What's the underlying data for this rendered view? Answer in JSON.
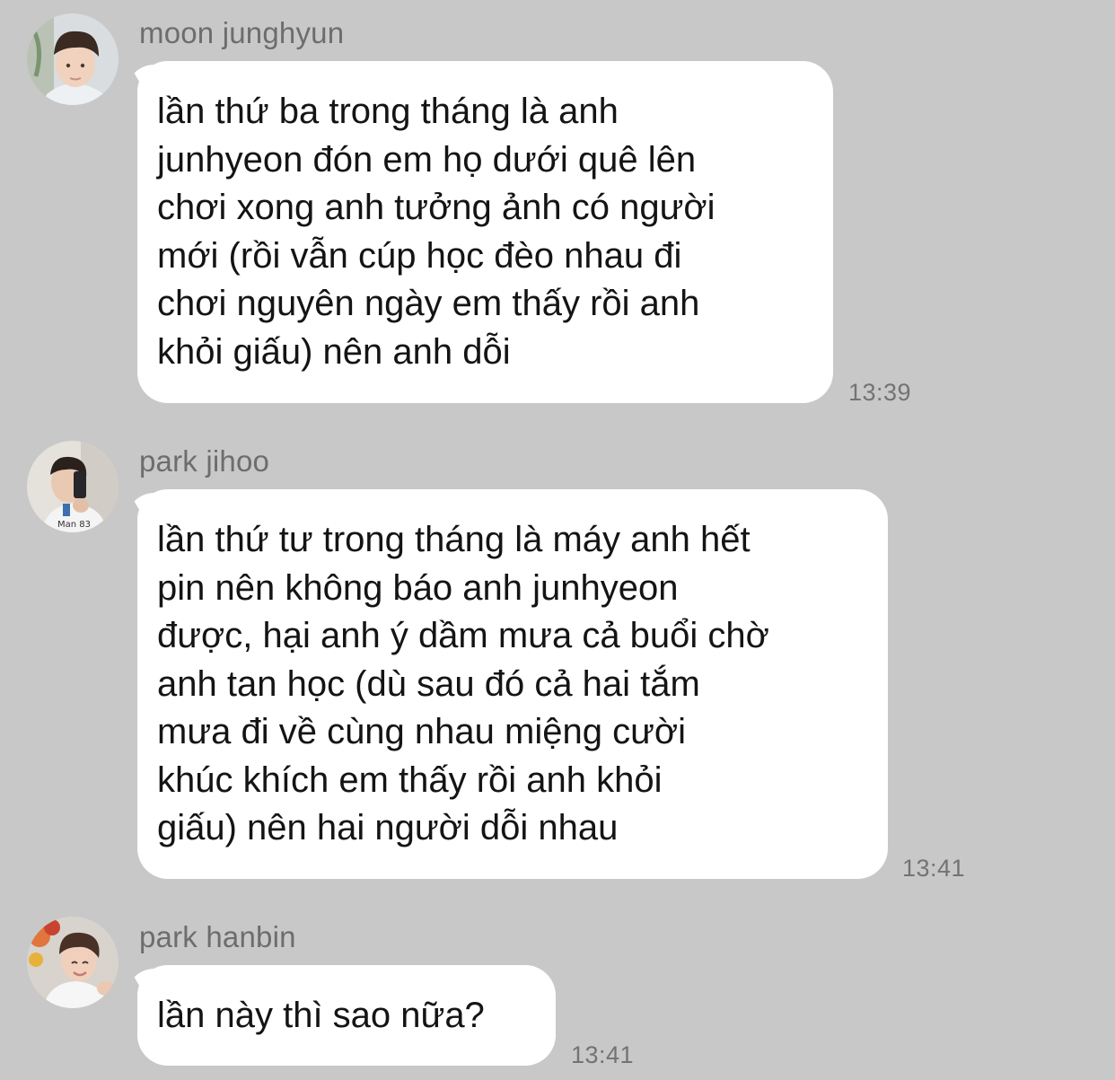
{
  "messages": [
    {
      "sender": "moon junghyun",
      "avatar_icon": "profile-photo-moon-junghyun",
      "text": "lần thứ ba trong tháng là anh\njunhyeon đón em họ dưới quê lên\nchơi xong anh tưởng ảnh có người\nmới (rồi vẫn cúp học đèo nhau đi\nchơi nguyên ngày em thấy rồi anh\nkhỏi giấu) nên anh dỗi",
      "time": "13:39"
    },
    {
      "sender": "park jihoo",
      "avatar_icon": "profile-photo-park-jihoo",
      "text": "lần thứ tư trong tháng là máy anh hết\npin nên không báo anh junhyeon\nđược, hại anh ý dầm mưa cả buổi chờ\nanh tan học (dù sau đó cả hai tắm\nmưa đi về cùng nhau miệng cười\nkhúc khích em thấy rồi anh khỏi\ngiấu) nên hai người dỗi nhau",
      "time": "13:41"
    },
    {
      "sender": "park hanbin",
      "avatar_icon": "profile-photo-park-hanbin",
      "text": "lần này thì sao nữa?",
      "time": "13:41"
    }
  ],
  "colors": {
    "background": "#c8c8c8",
    "bubble": "#ffffff",
    "text": "#141414",
    "sender": "#6d6d6d",
    "timestamp": "#737373"
  }
}
